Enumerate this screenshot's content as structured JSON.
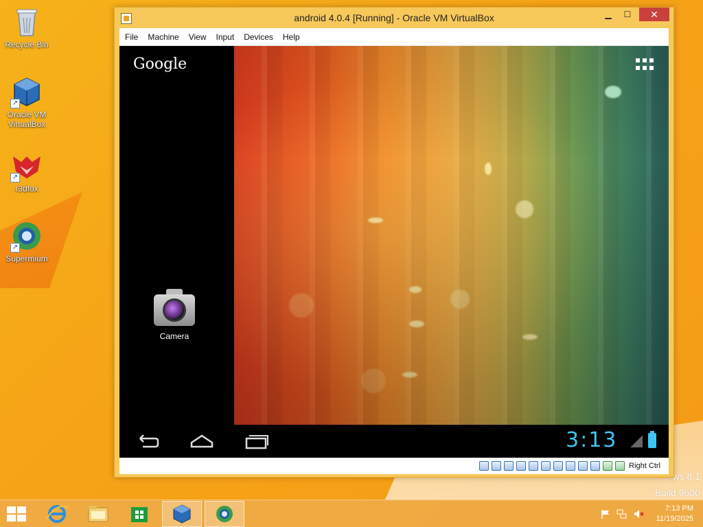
{
  "desktop": {
    "icons": [
      {
        "label": "Recycle Bin"
      },
      {
        "label": "Oracle VM VirtualBox"
      },
      {
        "label": "r3dfox"
      },
      {
        "label": "Supermium"
      }
    ],
    "watermark_line1": "ws 8.1",
    "watermark_line2": "Build 9600"
  },
  "window": {
    "title": "android 4.0.4 [Running] - Oracle VM VirtualBox",
    "minimize_glyph": "▁",
    "maximize_glyph": "☐",
    "close_glyph": "✕",
    "menu": [
      "File",
      "Machine",
      "View",
      "Input",
      "Devices",
      "Help"
    ],
    "host_key": "Right Ctrl"
  },
  "android": {
    "search_brand": "Google",
    "app_label": "Camera",
    "clock": "3:13"
  },
  "taskbar": {
    "time": "7:13 PM",
    "date": "11/19/2025"
  },
  "colors": {
    "desktop_orange": "#f6a317",
    "android_accent": "#3ec6f2",
    "close_red": "#c9413d"
  }
}
